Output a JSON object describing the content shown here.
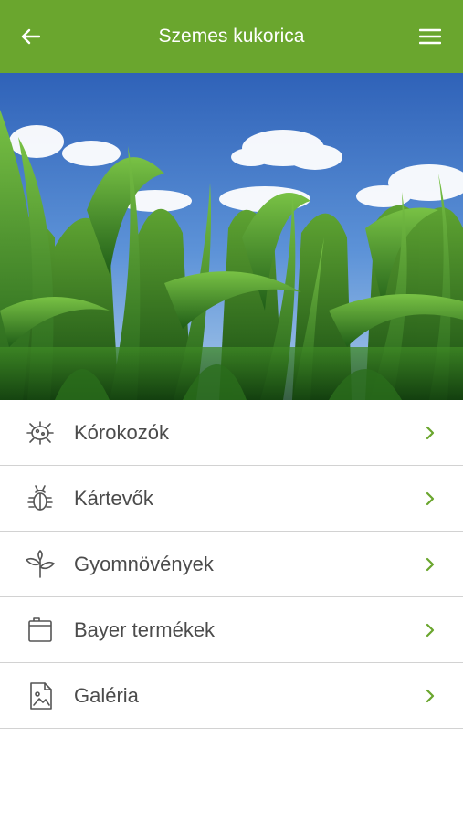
{
  "header": {
    "title": "Szemes kukorica",
    "back_icon": "arrow-left-icon",
    "menu_icon": "hamburger-menu-icon",
    "color": "#6aa62e"
  },
  "hero": {
    "description_icon": "corn-field-photo"
  },
  "menu": {
    "items": [
      {
        "label": "Kórokozók",
        "icon": "pathogen-icon"
      },
      {
        "label": "Kártevők",
        "icon": "bug-icon"
      },
      {
        "label": "Gyomnövények",
        "icon": "weed-plant-icon"
      },
      {
        "label": "Bayer termékek",
        "icon": "product-package-icon"
      },
      {
        "label": "Galéria",
        "icon": "gallery-image-icon"
      }
    ],
    "chevron_color": "#6aa62e"
  }
}
